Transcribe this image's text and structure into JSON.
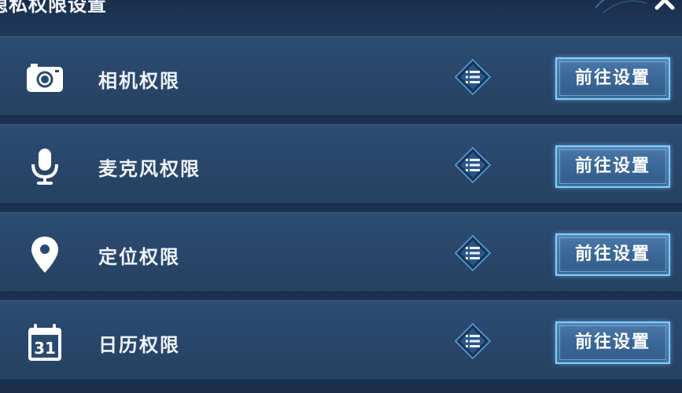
{
  "dialog": {
    "title": "隐私权限设置",
    "close_icon": "close-icon"
  },
  "permissions": [
    {
      "id": "camera",
      "icon": "camera-icon",
      "label": "相机权限",
      "action_label": "前往设置",
      "info_icon": "list-icon"
    },
    {
      "id": "microphone",
      "icon": "microphone-icon",
      "label": "麦克风权限",
      "action_label": "前往设置",
      "info_icon": "list-icon"
    },
    {
      "id": "location",
      "icon": "location-pin-icon",
      "label": "定位权限",
      "action_label": "前往设置",
      "info_icon": "list-icon"
    },
    {
      "id": "calendar",
      "icon": "calendar-icon",
      "label": "日历权限",
      "action_label": "前往设置",
      "info_icon": "list-icon",
      "icon_text": "31"
    }
  ],
  "colors": {
    "background": "#1b3150",
    "row": "#294669",
    "button_border": "#7fd0ff",
    "text": "#eef3f9"
  }
}
